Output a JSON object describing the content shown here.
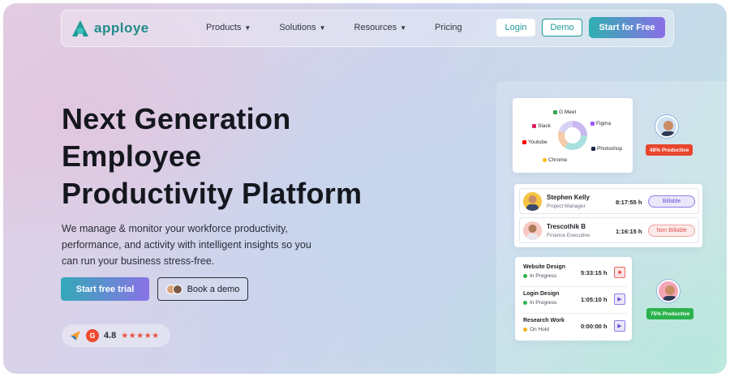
{
  "nav": {
    "logo_text": "apploye",
    "menu": [
      {
        "label": "Products",
        "has_dropdown": true
      },
      {
        "label": "Solutions",
        "has_dropdown": true
      },
      {
        "label": "Resources",
        "has_dropdown": true
      },
      {
        "label": "Pricing",
        "has_dropdown": false
      }
    ],
    "login_label": "Login",
    "demo_label": "Demo",
    "start_free_label": "Start for Free"
  },
  "hero": {
    "title_lines": [
      "Next Generation",
      "Employee",
      "Productivity Platform"
    ],
    "subtitle": "We manage & monitor your workforce productivity, performance, and activity with intelligent insights so you can run your business stress-free.",
    "trial_button": "Start free trial",
    "book_demo_button": "Book a demo",
    "rating_value": "4.8",
    "rating_stars": "★★★★★"
  },
  "apps_card": {
    "apps": [
      {
        "name": "G Meet",
        "color": "#34a853",
        "icon": "gmeet-icon"
      },
      {
        "name": "Slack",
        "color": "#e01e5a",
        "icon": "slack-icon"
      },
      {
        "name": "Figma",
        "color": "#a259ff",
        "icon": "figma-icon"
      },
      {
        "name": "Youtube",
        "color": "#ff0000",
        "icon": "youtube-icon"
      },
      {
        "name": "Photoshop",
        "color": "#1b2a4a",
        "icon": "photoshop-icon"
      },
      {
        "name": "Chrome",
        "color": "#fbbc05",
        "icon": "chrome-icon"
      }
    ]
  },
  "productivity_badges": [
    {
      "label": "48% Productive",
      "color": "#e8452c"
    },
    {
      "label": "75% Productive",
      "color": "#2bb24c"
    }
  ],
  "people": [
    {
      "name": "Stephen Kelly",
      "role": "Project Manager",
      "time": "8:17:55 h",
      "status": "Billable"
    },
    {
      "name": "Trescothik B",
      "role": "Finance Executive",
      "time": "1:16:15 h",
      "status": "Non Billable"
    }
  ],
  "tasks": [
    {
      "name": "Website Design",
      "status": "In Progress",
      "status_color": "#2bb24c",
      "time": "5:33:15 h",
      "control": "stop-icon"
    },
    {
      "name": "Login Design",
      "status": "In Progress",
      "status_color": "#2bb24c",
      "time": "1:05:10 h",
      "control": "play-icon"
    },
    {
      "name": "Research Work",
      "status": "On Hold",
      "status_color": "#f2b01e",
      "time": "0:00:00 h",
      "control": "play-icon"
    }
  ],
  "colors": {
    "brand_teal": "#1f9b96",
    "brand_purple": "#8a6ee8",
    "billable": "#6a55d6",
    "non_billable": "#d9534f"
  }
}
